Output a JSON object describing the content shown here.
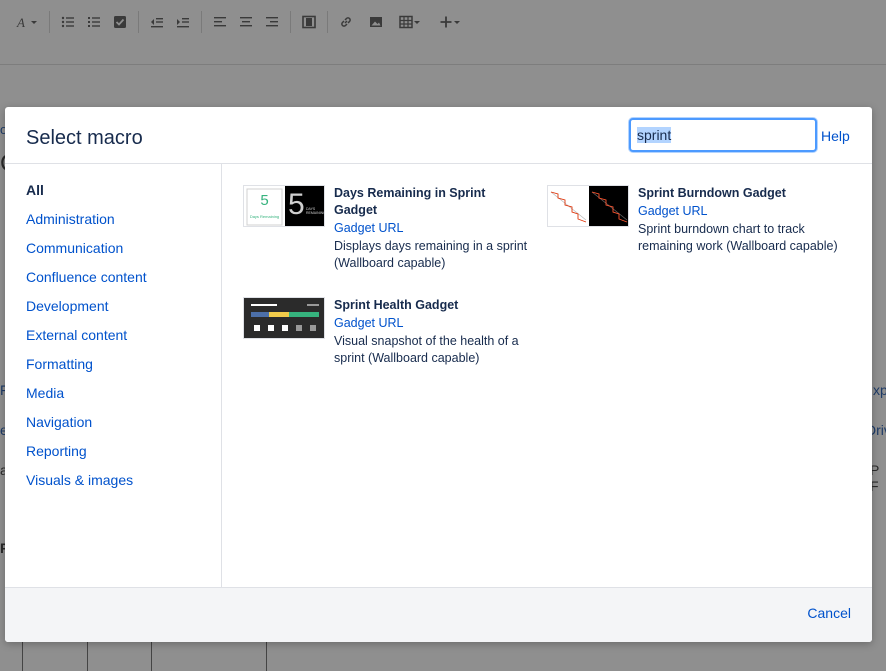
{
  "background": {
    "fragments": [
      "o",
      "C",
      "F",
      "e",
      "a",
      "P",
      "xp",
      "Driv",
      "P F"
    ]
  },
  "dialog": {
    "title": "Select macro",
    "search": {
      "value_selected": "sprint"
    },
    "help_label": "Help",
    "categories": [
      "All",
      "Administration",
      "Communication",
      "Confluence content",
      "Development",
      "External content",
      "Formatting",
      "Media",
      "Navigation",
      "Reporting",
      "Visuals & images"
    ],
    "macros": [
      {
        "name": "Days Remaining in Sprint Gadget",
        "link": "Gadget URL",
        "description": "Displays days remaining in a sprint (Wallboard capable)",
        "thumb": {
          "number": "5",
          "caption": "Days Remaining",
          "dark_caption": "DAYS REMAINING"
        }
      },
      {
        "name": "Sprint Burndown Gadget",
        "link": "Gadget URL",
        "description": "Sprint burndown chart to track remaining work (Wallboard capable)"
      },
      {
        "name": "Sprint Health Gadget",
        "link": "Gadget URL",
        "description": "Visual snapshot of the health of a sprint (Wallboard capable)"
      }
    ],
    "cancel_label": "Cancel"
  },
  "colors": {
    "link": "#0052cc",
    "text": "#172b4d",
    "focus": "#4c9aff",
    "overlay": "#8f8f8f"
  }
}
